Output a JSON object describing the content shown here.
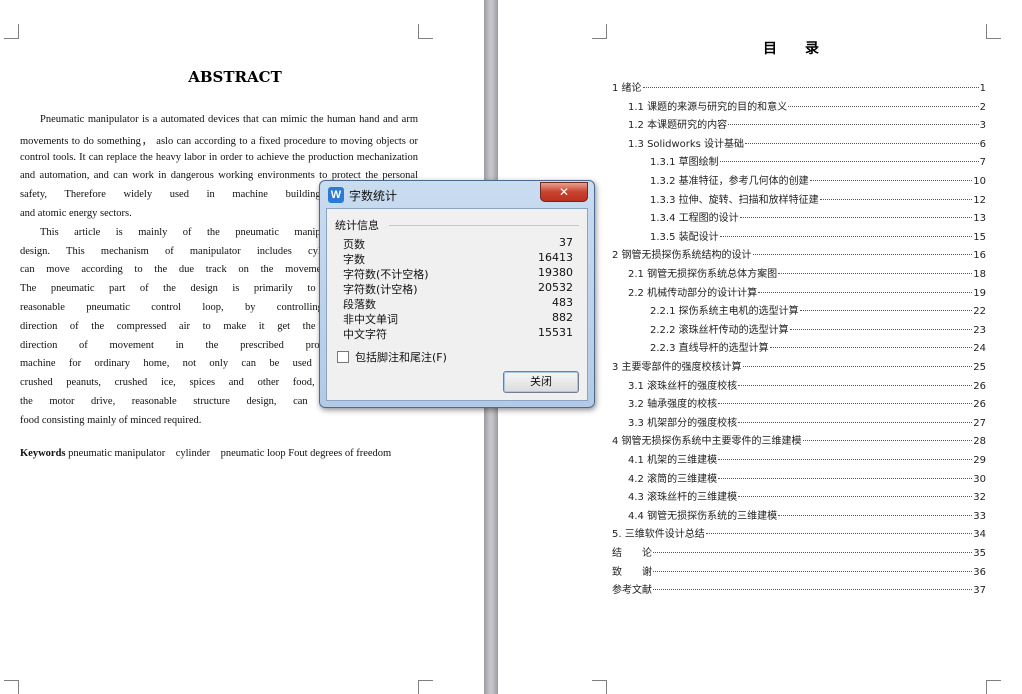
{
  "left_page": {
    "title": "ABSTRACT",
    "paragraph_lines": [
      "Pneumatic manipulator is a automated devices that can mimic the human hand and arm",
      "movements to do something， aslo can according to a fixed procedure to moving objects or",
      "control tools. It can replace the heavy labor in order to achieve the production mechanization",
      "and automation, and can work in dangerous working environments to protect the personal",
      "safety, Therefore widely used in machine building, metallurgy, ele",
      "and atomic energy sectors.",
      "This article is mainly of the pneumatic manipulator the overall",
      "design. This mechanism of manipulator includes cylinders and claws",
      "can move according to the due track on the movement of grabbing, c",
      "The pneumatic part of the design is primarily to choose the righ",
      "reasonable pneumatic control loop, by controlling and regulatin",
      "direction of the compressed air to make it get the necessary strength,",
      "direction of movement in the prescribed procedure work.Small",
      "machine for ordinary home, not only can be used for minced meat,",
      "crushed peanuts, crushed ice, spices and other food, small power req",
      "the motor drive, reasonable structure design, can meet the family",
      "food consisting mainly of minced required."
    ],
    "keywords_label": "Keywords",
    "keywords_text": " pneumatic manipulator    cylinder    pneumatic loop Fout degrees of freedom"
  },
  "right_page": {
    "title": "目　　录",
    "toc": [
      {
        "text": "1 绪论",
        "page": "1",
        "level": 0
      },
      {
        "text": "1.1 课题的来源与研究的目的和意义",
        "page": "2",
        "level": 1
      },
      {
        "text": "1.2 本课题研究的内容",
        "page": "3",
        "level": 1
      },
      {
        "text": "1.3 Solidworks 设计基础",
        "page": "6",
        "level": 1
      },
      {
        "text": "1.3.1 草图绘制",
        "page": "7",
        "level": 2
      },
      {
        "text": "1.3.2 基准特征，参考几何体的创建",
        "page": "10",
        "level": 2
      },
      {
        "text": "1.3.3 拉伸、旋转、扫描和放样特征建",
        "page": "12",
        "level": 2
      },
      {
        "text": "1.3.4 工程图的设计",
        "page": "13",
        "level": 2
      },
      {
        "text": "1.3.5 装配设计",
        "page": "15",
        "level": 2
      },
      {
        "text": "2 钢管无损探伤系统结构的设计",
        "page": "16",
        "level": 0
      },
      {
        "text": "2.1 钢管无损探伤系统总体方案图",
        "page": "18",
        "level": 1
      },
      {
        "text": "2.2 机械传动部分的设计计算",
        "page": "19",
        "level": 1
      },
      {
        "text": "2.2.1 探伤系统主电机的选型计算",
        "page": "22",
        "level": 2
      },
      {
        "text": "2.2.2 滚珠丝杆传动的选型计算",
        "page": "23",
        "level": 2
      },
      {
        "text": "2.2.3 直线导杆的选型计算",
        "page": "24",
        "level": 2
      },
      {
        "text": "3 主要零部件的强度校核计算",
        "page": "25",
        "level": 0
      },
      {
        "text": "3.1 滚珠丝杆的强度校核",
        "page": "26",
        "level": 1
      },
      {
        "text": "3.2 轴承强度的校核",
        "page": "26",
        "level": 1
      },
      {
        "text": "3.3 机架部分的强度校核",
        "page": "27",
        "level": 1
      },
      {
        "text": "4 钢管无损探伤系统中主要零件的三维建模",
        "page": "28",
        "level": 0
      },
      {
        "text": "4.1 机架的三维建模",
        "page": "29",
        "level": 1
      },
      {
        "text": "4.2 滚筒的三维建模",
        "page": "30",
        "level": 1
      },
      {
        "text": "4.3 滚珠丝杆的三维建模",
        "page": "32",
        "level": 1
      },
      {
        "text": "4.4 钢管无损探伤系统的三维建模",
        "page": "33",
        "level": 1
      },
      {
        "text": "5. 三维软件设计总结",
        "page": "34",
        "level": 0
      },
      {
        "text": "结　　论",
        "page": "35",
        "level": 0
      },
      {
        "text": "致　　谢",
        "page": "36",
        "level": 0
      },
      {
        "text": "参考文献",
        "page": "37",
        "level": 0
      }
    ]
  },
  "dialog": {
    "app_icon": "W",
    "title": "字数统计",
    "close_glyph": "✕",
    "group_label": "统计信息",
    "stats": [
      {
        "label": "页数",
        "value": "37"
      },
      {
        "label": "字数",
        "value": "16413"
      },
      {
        "label": "字符数(不计空格)",
        "value": "19380"
      },
      {
        "label": "字符数(计空格)",
        "value": "20532"
      },
      {
        "label": "段落数",
        "value": "483"
      },
      {
        "label": "非中文单词",
        "value": "882"
      },
      {
        "label": "中文字符",
        "value": "15531"
      }
    ],
    "include_label": "包括脚注和尾注(F)",
    "close_button": "关闭"
  },
  "colors": {
    "dialog_frame": "#b3cae6",
    "close_red": "#c8432e",
    "app_icon_blue": "#2a7ad6"
  }
}
